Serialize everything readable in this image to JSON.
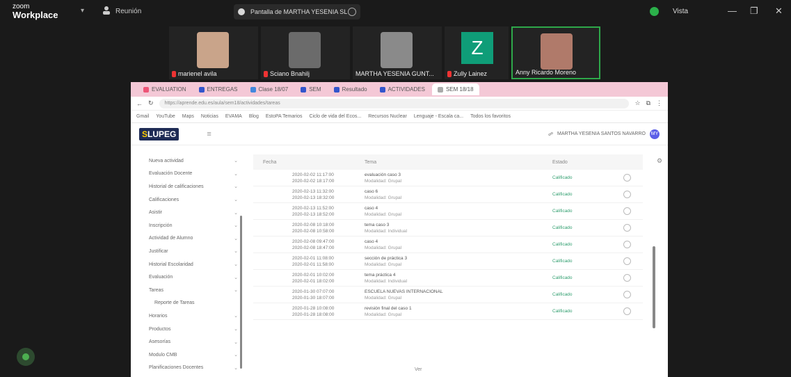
{
  "zoom": {
    "logo_top": "zoom",
    "logo_bottom": "Workplace",
    "meeting_label": "Reunión",
    "share_title": "Pantalla de MARTHA YESENIA SL",
    "view_label": "Vista"
  },
  "participants": [
    {
      "name": "marienel avila",
      "muted": true,
      "color": "#c9a48a"
    },
    {
      "name": "Sciano Bnahilj",
      "muted": true,
      "color": "#6b6b6b"
    },
    {
      "name": "MARTHA YESENIA GUNT...",
      "muted": false,
      "color": "#8a8a8a"
    },
    {
      "name": "Zully Lainez",
      "muted": true,
      "initial": "Z"
    },
    {
      "name": "Anny Ricardo Moreno",
      "muted": false,
      "color": "#b07a6a"
    }
  ],
  "browser": {
    "tabs": [
      "EVALUATION",
      "ENTREGAS",
      "Clase 18/07",
      "SEM",
      "Resultado",
      "ACTIVIDADES",
      "SEM 18/18"
    ],
    "url": "https://aprende.edu.es/aula/sem18/actividades/tareas",
    "bookmarks": [
      "Gmail",
      "YouTube",
      "Maps",
      "Noticias",
      "EVAMA",
      "Blog",
      "EstoPA Temarios",
      "Ciclo de vida del Ecos...",
      "Recursos Nuclear",
      "Lenguaje - Escala ca...",
      "Todos los favoritos"
    ]
  },
  "app": {
    "brand_a": "S",
    "brand_b": "LUPEG",
    "user_name": "MARTHA YESENIA SANTOS NAVARRO",
    "user_initials": "MY",
    "footer_label": "Ver"
  },
  "sidebar": [
    "Nueva actividad",
    "Evaluación Docente",
    "Historial de calificaciones",
    "Calificaciones",
    "Asistir",
    "Inscripción",
    "Actividad de Alumno",
    "Justificar",
    "Historial Escolaridad",
    "Evaluación",
    "Tareas",
    "Reporte de Tareas",
    "Horarios",
    "Productos",
    "Asesorías",
    "Modulo CMB",
    "Planificaciones Docentes"
  ],
  "table": {
    "headers": [
      "Fecha",
      "Tema",
      "Estado"
    ],
    "rows": [
      {
        "d1": "2020-02-02 11:17:00",
        "d2": "2020-02-02 18:17:00",
        "t": "evaluación caso 3",
        "s": "Modalidad: Grupal",
        "e": "Calificado"
      },
      {
        "d1": "2020-02-13 11:32:00",
        "d2": "2020-02-13 18:32:00",
        "t": "caso 6",
        "s": "Modalidad: Grupal",
        "e": "Calificado"
      },
      {
        "d1": "2020-02-13 11:52:00",
        "d2": "2020-02-13 18:52:00",
        "t": "caso 4",
        "s": "Modalidad: Grupal",
        "e": "Calificado"
      },
      {
        "d1": "2020-02-08 10:18:00",
        "d2": "2020-02-08 10:58:00",
        "t": "tema caso 3",
        "s": "Modalidad: Individual",
        "e": "Calificado"
      },
      {
        "d1": "2020-02-08 09:47:00",
        "d2": "2020-02-08 18:47:00",
        "t": "caso 4",
        "s": "Modalidad: Grupal",
        "e": "Calificado"
      },
      {
        "d1": "2020-02-01 11:08:00",
        "d2": "2020-02-01 11:58:00",
        "t": "sección de práctica 3",
        "s": "Modalidad: Grupal",
        "e": "Calificado"
      },
      {
        "d1": "2020-02-01 10:02:00",
        "d2": "2020-02-01 18:02:00",
        "t": "tema práctica 4",
        "s": "Modalidad: Individual",
        "e": "Calificado"
      },
      {
        "d1": "2020-01-30 07:07:00",
        "d2": "2020-01-30 18:07:00",
        "t": "ESCUELA NUEVAS INTERNACIONAL",
        "s": "Modalidad: Grupal",
        "e": "Calificado"
      },
      {
        "d1": "2020-01-28 10:08:00",
        "d2": "2020-01-28 18:08:00",
        "t": "revisión final del caso 1",
        "s": "Modalidad: Grupal",
        "e": "Calificado"
      }
    ]
  }
}
